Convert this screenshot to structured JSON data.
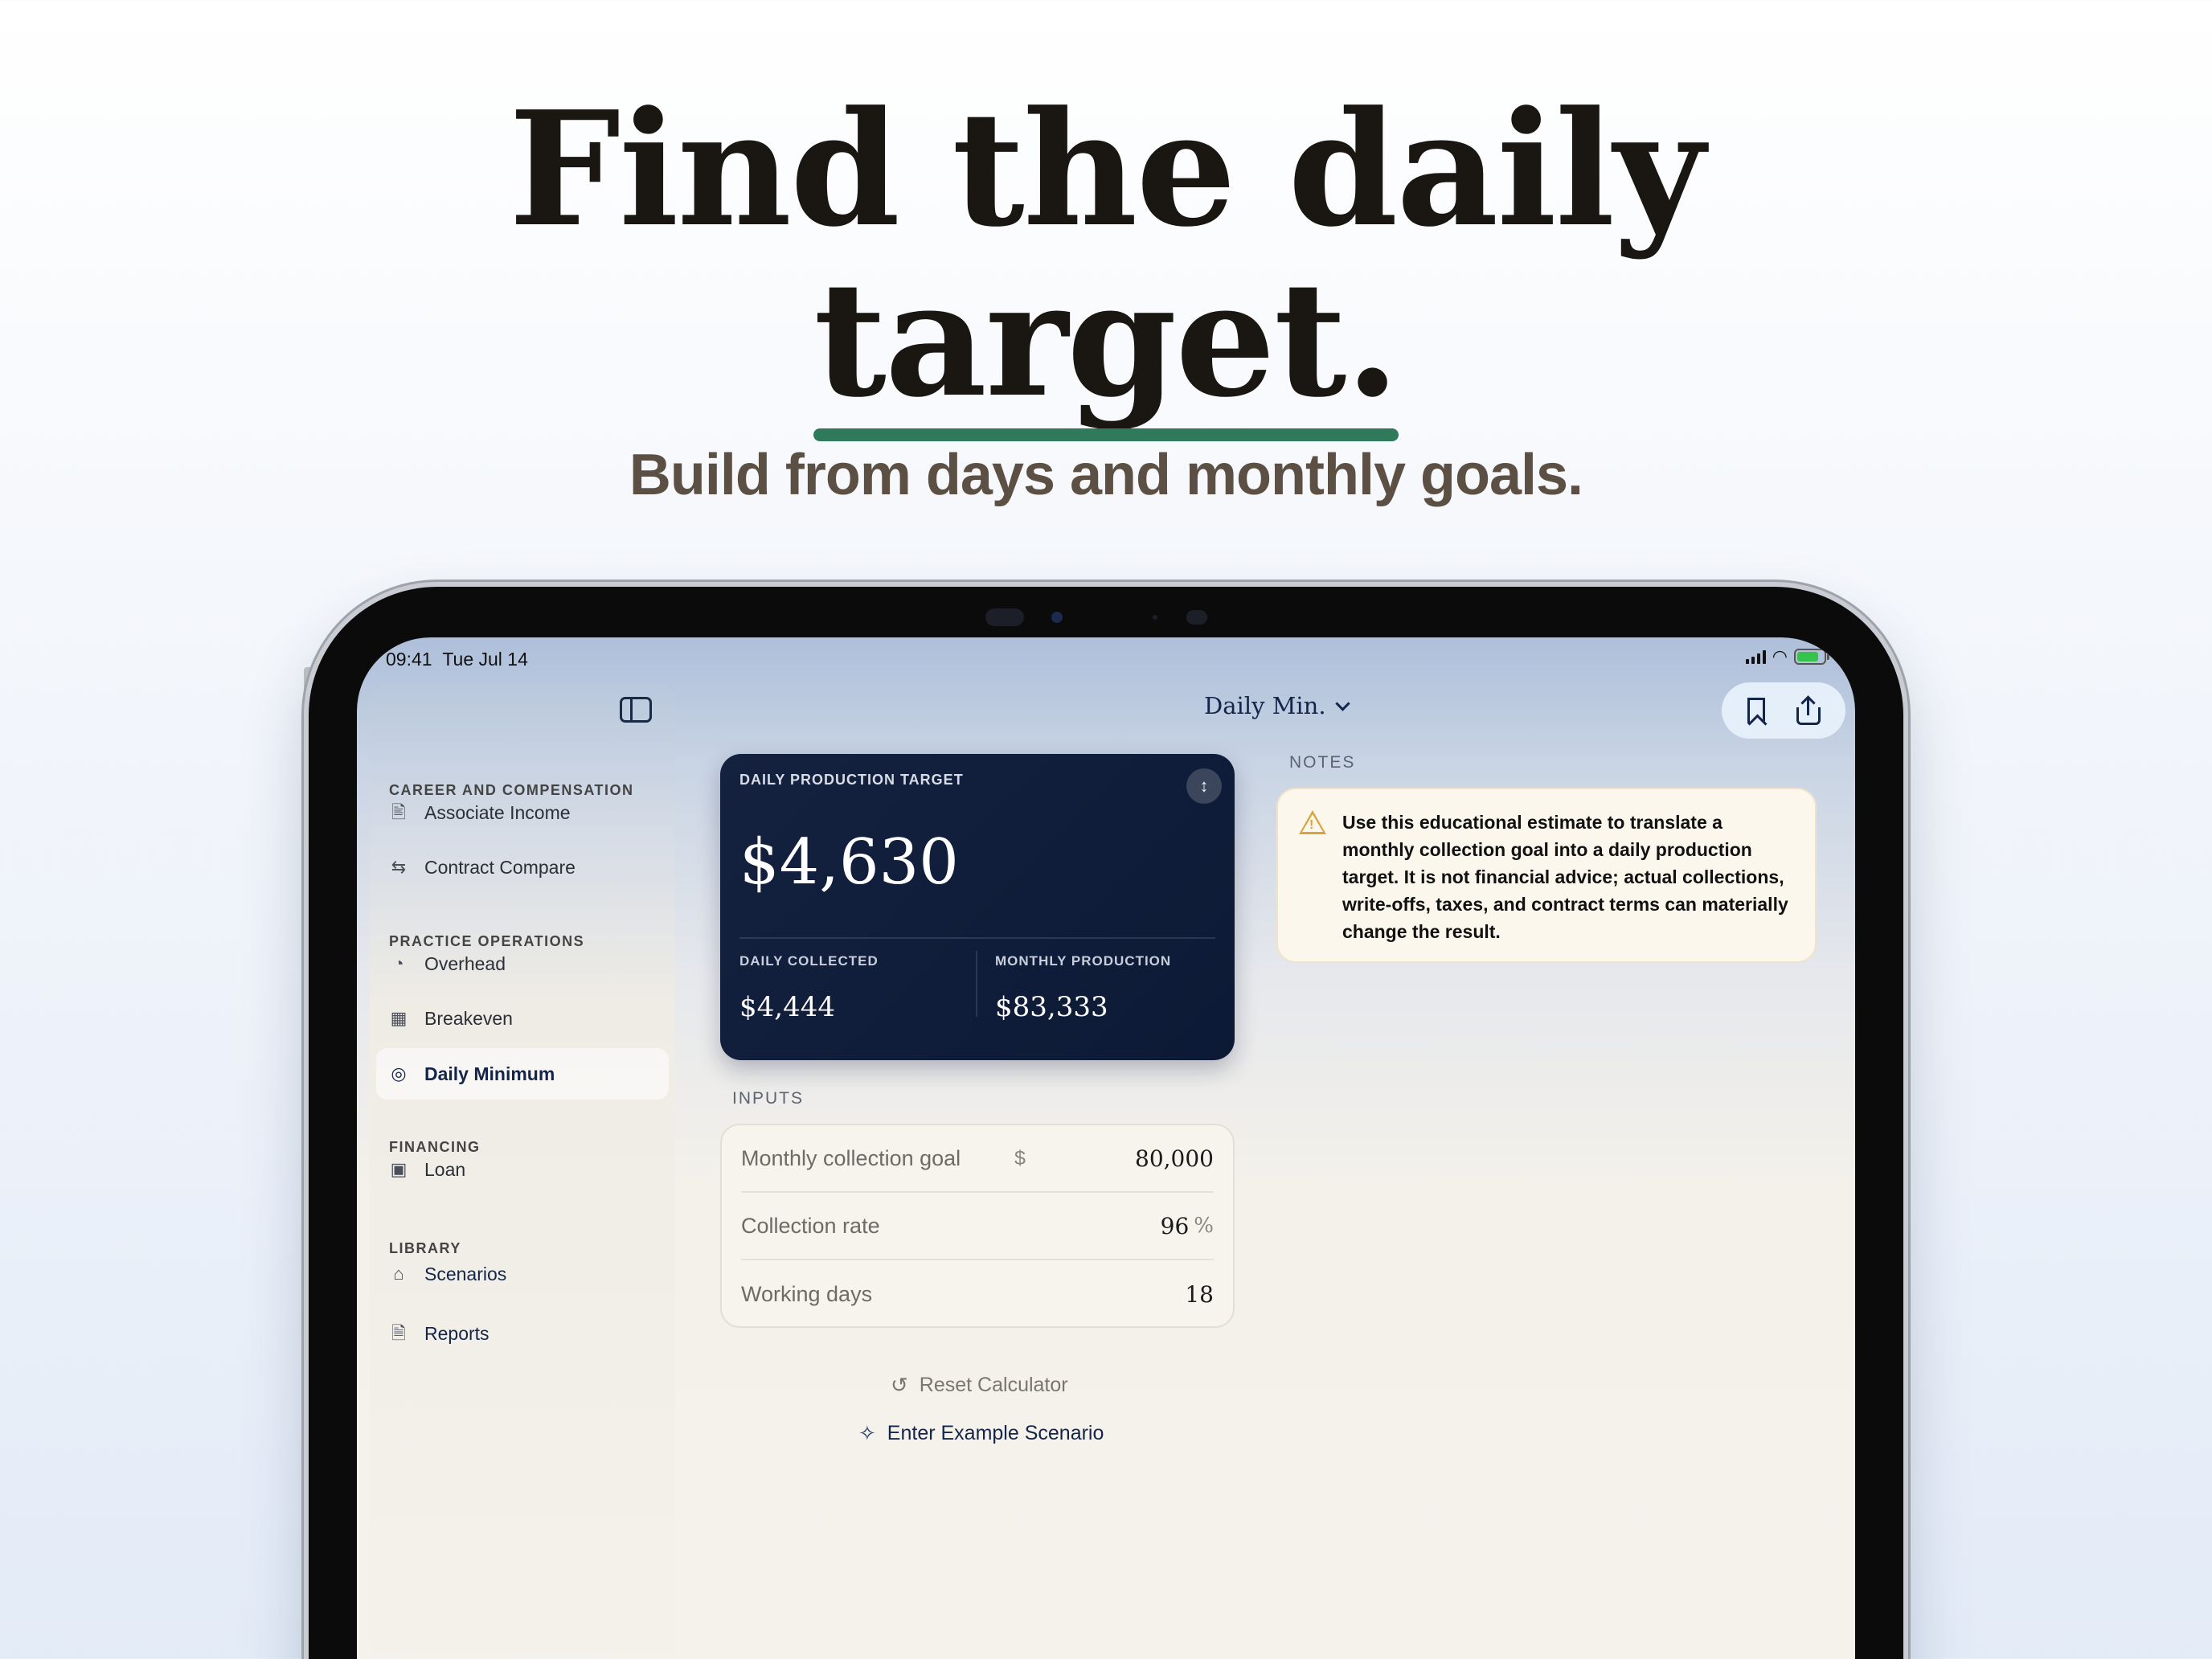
{
  "hero": {
    "headline_line1": "Find the daily",
    "headline_line2": "target.",
    "subhead": "Build from days and monthly goals.",
    "accent_color": "#2f7a5a"
  },
  "status_bar": {
    "time": "09:41",
    "date": "Tue Jul 14"
  },
  "sidebar": {
    "sections": [
      {
        "title": "CAREER AND COMPENSATION"
      },
      {
        "title": "PRACTICE OPERATIONS"
      },
      {
        "title": "FINANCING"
      },
      {
        "title": "LIBRARY"
      }
    ],
    "items": [
      {
        "label": "Associate Income",
        "icon": "id-card-icon"
      },
      {
        "label": "Contract Compare",
        "icon": "swap-arrows-icon"
      },
      {
        "label": "Overhead",
        "icon": "pie-chart-icon"
      },
      {
        "label": "Breakeven",
        "icon": "calendar-grid-icon"
      },
      {
        "label": "Daily Minimum",
        "icon": "target-icon",
        "selected": true
      },
      {
        "label": "Loan",
        "icon": "banknote-icon"
      },
      {
        "label": "Scenarios",
        "icon": "tray-icon"
      },
      {
        "label": "Reports",
        "icon": "document-icon"
      }
    ]
  },
  "toolbar": {
    "title": "Daily Min."
  },
  "result": {
    "label": "DAILY PRODUCTION TARGET",
    "value": "$4,630",
    "daily_collected_label": "DAILY COLLECTED",
    "daily_collected_value": "$4,444",
    "monthly_production_label": "MONTHLY PRODUCTION",
    "monthly_production_value": "$83,333",
    "card_color": "#0c1a36"
  },
  "inputs": {
    "heading": "INPUTS",
    "rows": [
      {
        "label": "Monthly collection goal",
        "prefix": "$",
        "value": "80,000",
        "unit": ""
      },
      {
        "label": "Collection rate",
        "prefix": "",
        "value": "96",
        "unit": "%"
      },
      {
        "label": "Working days",
        "prefix": "",
        "value": "18",
        "unit": ""
      }
    ]
  },
  "actions": {
    "reset_label": "Reset Calculator",
    "example_label": "Enter Example Scenario"
  },
  "notes": {
    "heading": "NOTES",
    "text": "Use this educational estimate to translate a monthly collection goal into a daily production target. It is not financial advice; actual collections, write-offs, taxes, and contract terms can materially change the result.",
    "warning_color": "#d9a43c"
  }
}
